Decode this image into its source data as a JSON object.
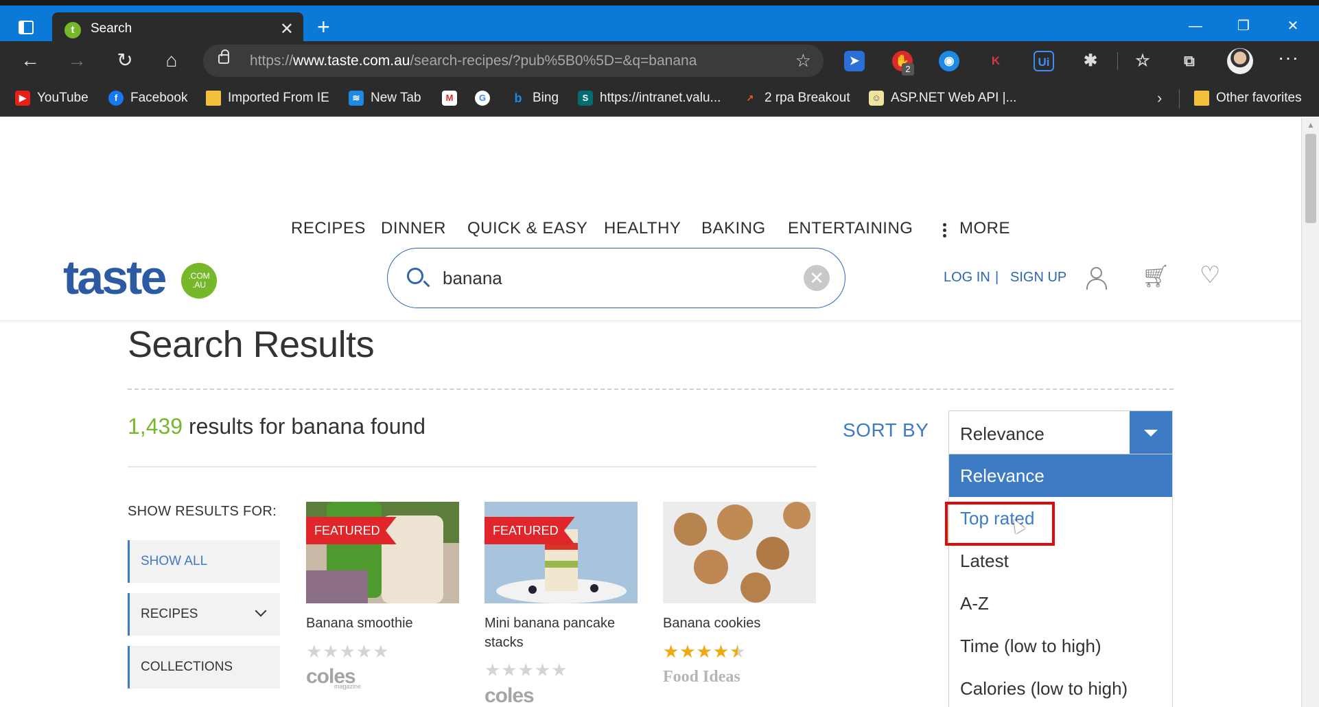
{
  "browser": {
    "tab_title": "Search",
    "url_prefix": "https://",
    "url_domain": "www.taste.com.au",
    "url_path": "/search-recipes/?pub%5B0%5D=&q=banana",
    "ext_badge": "2",
    "bookmarks": [
      {
        "label": "YouTube",
        "icon": "youtube-icon"
      },
      {
        "label": "Facebook",
        "icon": "facebook-icon"
      },
      {
        "label": "Imported From IE",
        "icon": "folder-icon"
      },
      {
        "label": "New Tab",
        "icon": "wifi-icon"
      },
      {
        "label": "",
        "icon": "gmail-icon"
      },
      {
        "label": "",
        "icon": "google-icon"
      },
      {
        "label": "Bing",
        "icon": "bing-icon"
      },
      {
        "label": "https://intranet.valu...",
        "icon": "sharepoint-icon"
      },
      {
        "label": "2 rpa Breakout",
        "icon": "chart-icon"
      },
      {
        "label": "ASP.NET Web API |...",
        "icon": "aspnet-icon"
      }
    ],
    "other_favorites": "Other favorites"
  },
  "site": {
    "logo_text": "taste",
    "logo_badge_top": ".COM",
    "logo_badge_bottom": ".AU",
    "nav": [
      "RECIPES",
      "DINNER",
      "QUICK & EASY",
      "HEALTHY",
      "BAKING",
      "ENTERTAINING",
      "MORE"
    ],
    "search_value": "banana",
    "login": "LOG IN",
    "separator": "|",
    "signup": "SIGN UP"
  },
  "results": {
    "title": "Search Results",
    "count": "1,439",
    "count_suffix": " results for banana found",
    "sort_label": "SORT BY",
    "sort_selected": "Relevance",
    "sort_options": [
      "Relevance",
      "Top rated",
      "Latest",
      "A-Z",
      "Time (low to high)",
      "Calories (low to high)"
    ]
  },
  "filters": {
    "heading": "SHOW RESULTS FOR:",
    "items": [
      "SHOW ALL",
      "RECIPES",
      "COLLECTIONS"
    ]
  },
  "cards": [
    {
      "title": "Banana smoothie",
      "badge": "FEATURED",
      "rating": 0,
      "stars": "★★★★★",
      "brand": "coles",
      "brand_sub": "magazine"
    },
    {
      "title": "Mini banana pancake stacks",
      "badge": "FEATURED",
      "rating": 0,
      "stars": "★★★★★",
      "brand": "coles",
      "brand_sub": ""
    },
    {
      "title": "Banana cookies",
      "badge": "",
      "rating": 4.5,
      "stars": "★★★★★",
      "brand": "Food Ideas",
      "brand_sub": ""
    }
  ],
  "colors": {
    "accent_blue": "#3d7bc4",
    "brand_green": "#77b82a",
    "featured_red": "#e0252b",
    "star_gold": "#f2a811"
  }
}
